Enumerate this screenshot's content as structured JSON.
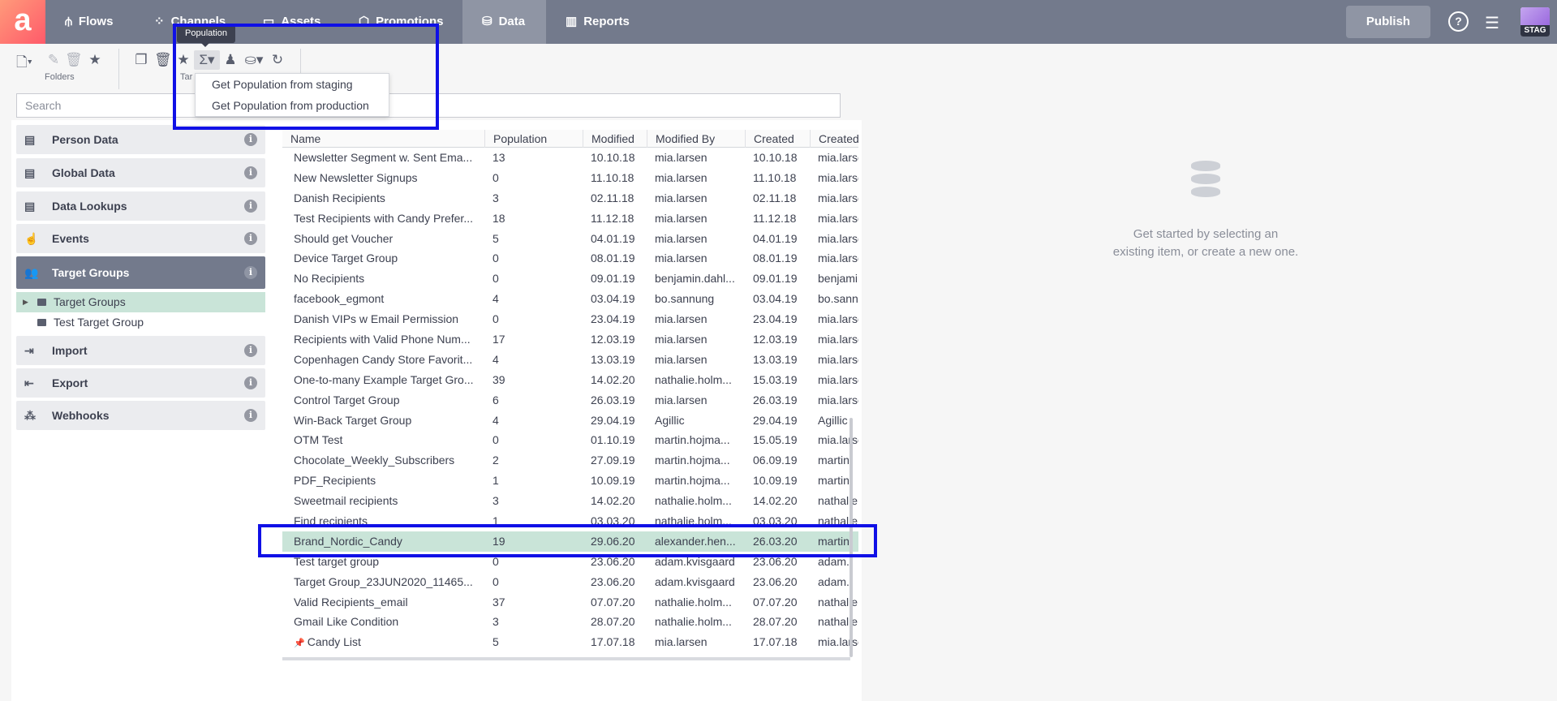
{
  "topbar": {
    "nav": [
      {
        "label": "Flows",
        "icon": "flows-icon",
        "active": false
      },
      {
        "label": "Channels",
        "icon": "channels-icon",
        "active": false
      },
      {
        "label": "Assets",
        "icon": "assets-icon",
        "active": false
      },
      {
        "label": "Promotions",
        "icon": "promotions-icon",
        "active": false
      },
      {
        "label": "Data",
        "icon": "database-icon",
        "active": true
      },
      {
        "label": "Reports",
        "icon": "reports-icon",
        "active": false
      }
    ],
    "publish_label": "Publish",
    "help_label": "?",
    "env_badge": "STAG"
  },
  "toolbar": {
    "folders_label": "Folders",
    "target_label": "Tar",
    "tooltip": "Population",
    "population_menu": [
      "Get Population from staging",
      "Get Population from production"
    ]
  },
  "search": {
    "placeholder": "Search"
  },
  "sidebar": {
    "items": [
      {
        "label": "Person Data"
      },
      {
        "label": "Global Data"
      },
      {
        "label": "Data Lookups"
      },
      {
        "label": "Events"
      },
      {
        "label": "Target Groups",
        "active": true
      },
      {
        "label": "Import"
      },
      {
        "label": "Export"
      },
      {
        "label": "Webhooks"
      }
    ],
    "tree": [
      {
        "label": "Target Groups",
        "selected": true
      },
      {
        "label": "Test Target Group",
        "selected": false
      }
    ]
  },
  "table": {
    "columns": [
      "Name",
      "Population",
      "Modified",
      "Modified By",
      "Created",
      "Created By"
    ],
    "rows": [
      [
        "Newsletter Segment w. Sent Ema...",
        "13",
        "10.10.18",
        "mia.larsen",
        "10.10.18",
        "mia.larsen"
      ],
      [
        "New Newsletter Signups",
        "0",
        "11.10.18",
        "mia.larsen",
        "11.10.18",
        "mia.larsen"
      ],
      [
        "Danish Recipients",
        "3",
        "02.11.18",
        "mia.larsen",
        "02.11.18",
        "mia.larsen"
      ],
      [
        "Test Recipients with Candy Prefer...",
        "18",
        "11.12.18",
        "mia.larsen",
        "11.12.18",
        "mia.larsen"
      ],
      [
        "Should get Voucher",
        "5",
        "04.01.19",
        "mia.larsen",
        "04.01.19",
        "mia.larsen"
      ],
      [
        "Device Target Group",
        "0",
        "08.01.19",
        "mia.larsen",
        "08.01.19",
        "mia.larsen"
      ],
      [
        "No Recipients",
        "0",
        "09.01.19",
        "benjamin.dahl...",
        "09.01.19",
        "benjamin.dahl..."
      ],
      [
        "facebook_egmont",
        "4",
        "03.04.19",
        "bo.sannung",
        "03.04.19",
        "bo.sannung"
      ],
      [
        "Danish VIPs w Email Permission",
        "0",
        "23.04.19",
        "mia.larsen",
        "23.04.19",
        "mia.larsen"
      ],
      [
        "Recipients with Valid Phone Num...",
        "17",
        "12.03.19",
        "mia.larsen",
        "12.03.19",
        "mia.larsen"
      ],
      [
        "Copenhagen Candy Store Favorit...",
        "4",
        "13.03.19",
        "mia.larsen",
        "13.03.19",
        "mia.larsen"
      ],
      [
        "One-to-many Example Target Gro...",
        "39",
        "14.02.20",
        "nathalie.holm...",
        "15.03.19",
        "mia.larsen"
      ],
      [
        "Control Target Group",
        "6",
        "26.03.19",
        "mia.larsen",
        "26.03.19",
        "mia.larsen"
      ],
      [
        "Win-Back Target Group",
        "4",
        "29.04.19",
        "Agillic",
        "29.04.19",
        "Agillic"
      ],
      [
        "OTM Test",
        "0",
        "01.10.19",
        "martin.hojma...",
        "15.05.19",
        "mia.larsen"
      ],
      [
        "Chocolate_Weekly_Subscribers",
        "2",
        "27.09.19",
        "martin.hojma...",
        "06.09.19",
        "martin"
      ],
      [
        "PDF_Recipients",
        "1",
        "10.09.19",
        "martin.hojma...",
        "10.09.19",
        "martin"
      ],
      [
        "Sweetmail recipients",
        "3",
        "14.02.20",
        "nathalie.holm...",
        "14.02.20",
        "nathalie"
      ],
      [
        "Find recipients",
        "1",
        "03.03.20",
        "nathalie.holm...",
        "03.03.20",
        "nathalie"
      ],
      [
        "Brand_Nordic_Candy",
        "19",
        "29.06.20",
        "alexander.hen...",
        "26.03.20",
        "martin"
      ],
      [
        "Test target group",
        "0",
        "23.06.20",
        "adam.kvisgaard",
        "23.06.20",
        "adam."
      ],
      [
        "Target Group_23JUN2020_11465...",
        "0",
        "23.06.20",
        "adam.kvisgaard",
        "23.06.20",
        "adam."
      ],
      [
        "Valid Recipients_email",
        "37",
        "07.07.20",
        "nathalie.holm...",
        "07.07.20",
        "nathalie"
      ],
      [
        "Gmail Like Condition",
        "3",
        "28.07.20",
        "nathalie.holm...",
        "28.07.20",
        "nathalie"
      ],
      [
        "Candy List",
        "5",
        "17.07.18",
        "mia.larsen",
        "17.07.18",
        "mia.larsen"
      ]
    ],
    "selected_row": 19,
    "pinned_row": 24
  },
  "empty_state": {
    "line1": "Get started by selecting an",
    "line2": "existing item, or create a new one."
  },
  "colors": {
    "topbar": "#737a8c",
    "selected": "#c9e4d8",
    "highlight": "#1010e6",
    "brand": "#ff5a6a"
  }
}
